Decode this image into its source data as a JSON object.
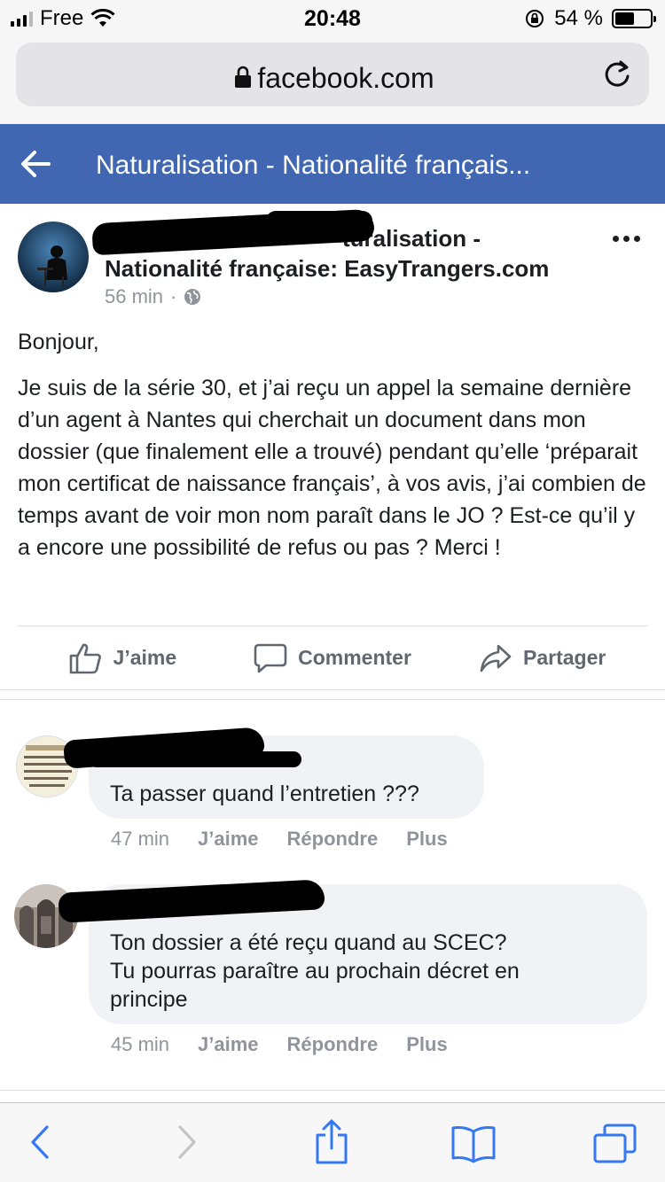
{
  "status_bar": {
    "carrier": "Free",
    "time": "20:48",
    "battery": "54 %",
    "battery_level": 0.54
  },
  "browser": {
    "domain": "facebook.com"
  },
  "header": {
    "title": "Naturalisation - Nationalité français..."
  },
  "post": {
    "group_line1": "turalisation -",
    "group_line2": "Nationalité française: EasyTrangers.com",
    "time": "56 min",
    "dot": "·",
    "paragraphs": [
      "Bonjour,",
      "Je suis de la série 30, et j’ai reçu un appel la semaine dernière d’un agent à Nantes qui cherchait un document dans mon dossier (que finalement elle a trouvé) pendant qu’elle ‘préparait mon certificat de naissance français’, à vos avis, j’ai combien de temps avant de voir mon nom paraît dans le JO ? Est-ce qu’il y a encore une possibilité de refus ou pas ? Merci !"
    ],
    "actions": {
      "like": "J’aime",
      "comment": "Commenter",
      "share": "Partager"
    }
  },
  "comments": [
    {
      "text": "Ta passer quand l’entretien ???",
      "time": "47 min",
      "like": "J’aime",
      "reply": "Répondre",
      "more": "Plus"
    },
    {
      "text_lines": [
        "Ton dossier a été reçu quand au SCEC?",
        "Tu pourras paraître au prochain décret en",
        "principe"
      ],
      "time": "45 min",
      "like": "J’aime",
      "reply": "Répondre",
      "more": "Plus"
    }
  ],
  "colors": {
    "fb_blue": "#4267b2",
    "ios_blue": "#3478f6",
    "secondary_text": "#90949c"
  }
}
